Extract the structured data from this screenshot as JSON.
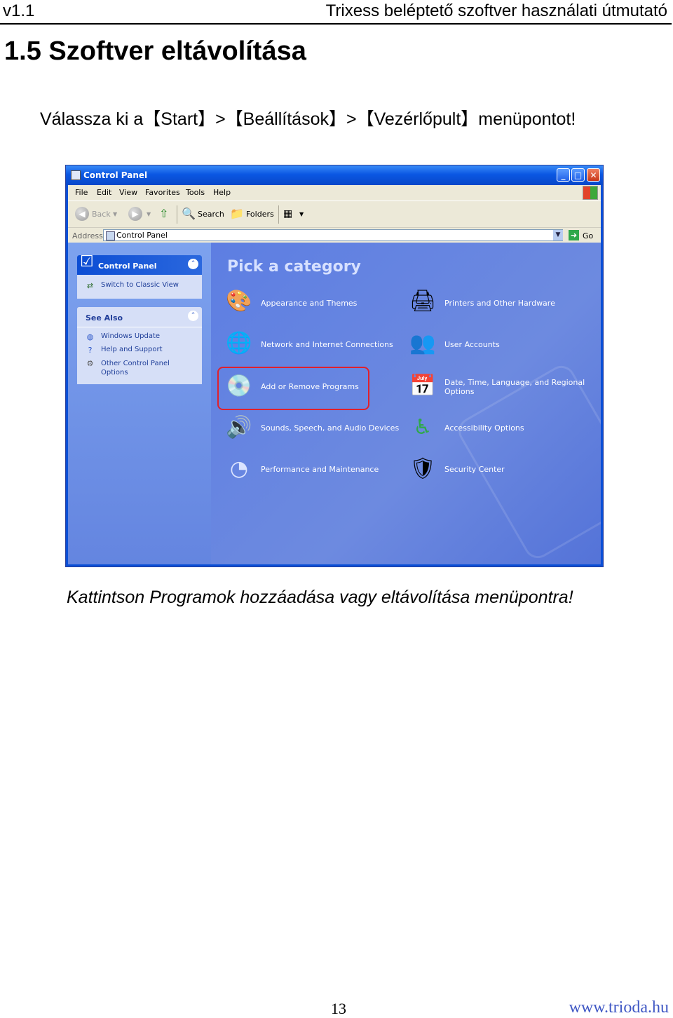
{
  "header": {
    "version": "v1.1",
    "doc_title": "Trixess beléptető szoftver használati útmutató"
  },
  "section_heading": "1.5 Szoftver eltávolítása",
  "instruction": "Válassza ki a【Start】>【Beállítások】>【Vezérlőpult】menüpontot!",
  "caption": "Kattintson Programok hozzáadása vagy eltávolítása menüpontra!",
  "footer": {
    "page_number": "13",
    "website": "www.trioda.hu"
  },
  "window": {
    "title": "Control Panel",
    "menu": [
      "File",
      "Edit",
      "View",
      "Favorites",
      "Tools",
      "Help"
    ],
    "toolbar": {
      "back": "Back",
      "search": "Search",
      "folders": "Folders"
    },
    "address": {
      "label": "Address",
      "value": "Control Panel",
      "go": "Go"
    },
    "left_panel": {
      "title": "Control Panel",
      "switch_link": "Switch to Classic View",
      "see_also_title": "See Also",
      "see_also": [
        "Windows Update",
        "Help and Support",
        "Other Control Panel Options"
      ]
    },
    "main": {
      "heading": "Pick a category",
      "categories": [
        {
          "label": "Appearance and Themes",
          "icon": "appearance-icon"
        },
        {
          "label": "Printers and Other Hardware",
          "icon": "printer-icon"
        },
        {
          "label": "Network and Internet Connections",
          "icon": "network-icon"
        },
        {
          "label": "User Accounts",
          "icon": "users-icon"
        },
        {
          "label": "Add or Remove Programs",
          "icon": "add-remove-icon",
          "highlighted": true
        },
        {
          "label": "Date, Time, Language, and Regional Options",
          "icon": "calendar-icon"
        },
        {
          "label": "Sounds, Speech, and Audio Devices",
          "icon": "speaker-icon"
        },
        {
          "label": "Accessibility Options",
          "icon": "accessibility-icon"
        },
        {
          "label": "Performance and Maintenance",
          "icon": "pie-chart-icon"
        },
        {
          "label": "Security Center",
          "icon": "shield-icon"
        }
      ],
      "highlight_color": "#e0202c"
    }
  }
}
